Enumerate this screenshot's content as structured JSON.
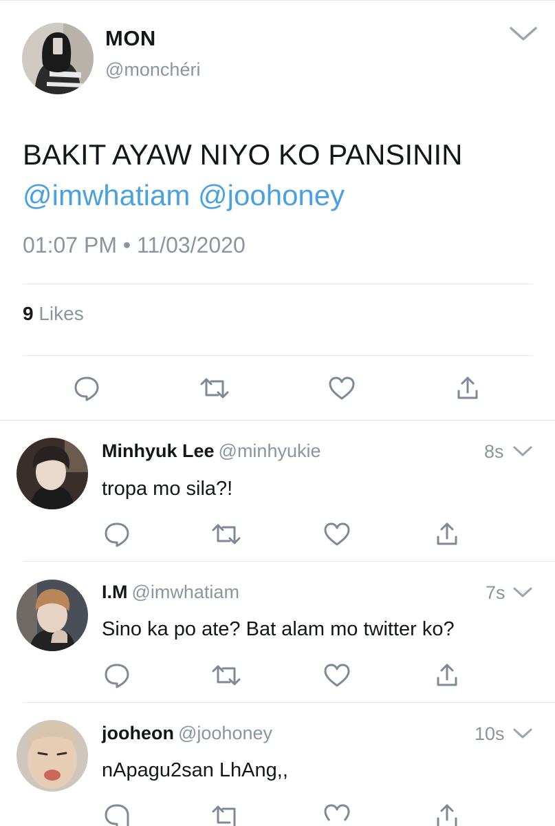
{
  "main_tweet": {
    "name": "MON",
    "handle": "@monchéri",
    "text": "BAKIT AYAW NIYO KO PANSININ",
    "mention1": "@imwhatiam",
    "mention2": "@joohoney",
    "timestamp": "01:07 PM • 11/03/2020",
    "likes_count": "9",
    "likes_label": "Likes",
    "chevron_icon": "chevron-down-icon"
  },
  "actions": {
    "reply_icon": "reply-icon",
    "retweet_icon": "retweet-icon",
    "like_icon": "heart-icon",
    "share_icon": "share-icon"
  },
  "replies": [
    {
      "name": "Minhyuk Lee",
      "handle": "@minhyukie",
      "time": "8s",
      "text": "tropa mo sila?!"
    },
    {
      "name": "I.M",
      "handle": "@imwhatiam",
      "time": "7s",
      "text": "Sino ka po ate? Bat alam mo twitter ko?"
    },
    {
      "name": "jooheon",
      "handle": "@joohoney",
      "time": "10s",
      "text": "nApagu2san LhAng,,"
    }
  ],
  "colors": {
    "mention": "#4aa1e0",
    "secondary_text": "#8a959e",
    "icon": "#7d8a96",
    "divider": "#e1e8ed"
  }
}
